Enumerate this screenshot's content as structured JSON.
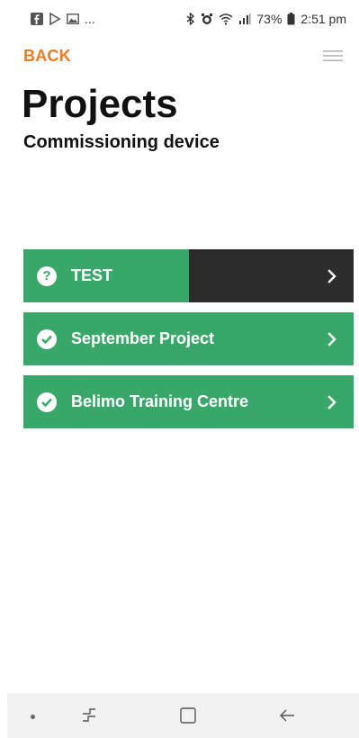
{
  "status_bar": {
    "notification_icons": [
      "facebook-icon",
      "play-store-icon",
      "gallery-icon"
    ],
    "more_notifications": "...",
    "system_icons": [
      "bluetooth-icon",
      "alarm-icon",
      "wifi-icon",
      "signal-icon"
    ],
    "battery": "73%",
    "time": "2:51 pm"
  },
  "header": {
    "back_label": "BACK",
    "menu_icon": "hamburger-menu-icon"
  },
  "page": {
    "title": "Projects",
    "subtitle": "Commissioning device"
  },
  "projects": [
    {
      "name": "TEST",
      "status": "unknown",
      "status_icon": "question-circle-icon",
      "progress_fraction": 0.5
    },
    {
      "name": "September Project",
      "status": "complete",
      "status_icon": "check-circle-icon",
      "progress_fraction": 1.0
    },
    {
      "name": "Belimo Training Centre",
      "status": "complete",
      "status_icon": "check-circle-icon",
      "progress_fraction": 1.0
    }
  ],
  "colors": {
    "accent": "#f47a20",
    "item_green": "#3aa76a",
    "item_dark": "#2c2c2c"
  },
  "nav_bar": {
    "buttons": [
      "dot-indicator",
      "recent-apps-icon",
      "home-icon",
      "back-arrow-icon"
    ]
  }
}
